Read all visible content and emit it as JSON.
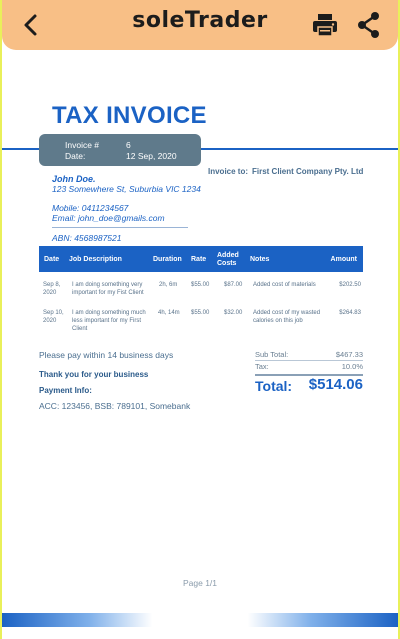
{
  "app": {
    "title": "soleTrader",
    "icons": [
      "back-arrow-icon",
      "printer-icon",
      "share-icon"
    ]
  },
  "invoice": {
    "heading": "TAX INVOICE",
    "meta": {
      "number_label": "Invoice #",
      "number": "6",
      "date_label": "Date:",
      "date": "12 Sep, 2020"
    },
    "from": {
      "name": "John Doe.",
      "address": "123 Somewhere St, Suburbia VIC 1234",
      "mobile": "Mobile: 0411234567",
      "email": "Email: john_doe@gmails.com",
      "abn": "ABN: 4568987521"
    },
    "to_label": "Invoice to:",
    "to_value": "First Client Company Pty. Ltd",
    "table": {
      "headers": {
        "date": "Date",
        "desc": "Job Description",
        "duration": "Duration",
        "rate": "Rate",
        "added_costs": "Added Costs",
        "notes": "Notes",
        "amount": "Amount"
      },
      "rows": [
        {
          "date_l1": "Sep 8,",
          "date_l2": "2020",
          "desc_l1": "I am doing something very",
          "desc_l2": "important for my Fist Client",
          "desc_l3": "",
          "duration": "2h, 6m",
          "rate": "$55.00",
          "added_costs": "$87.00",
          "notes_l1": "Added cost of materials",
          "notes_l2": "",
          "amount": "$202.50"
        },
        {
          "date_l1": "Sep 10,",
          "date_l2": "2020",
          "desc_l1": "I am doing something much",
          "desc_l2": "less important for my First",
          "desc_l3": "Client",
          "duration": "4h, 14m",
          "rate": "$55.00",
          "added_costs": "$32.00",
          "notes_l1": "Added cost of my wasted",
          "notes_l2": "calories on this job",
          "amount": "$264.83"
        }
      ]
    },
    "notes": {
      "pay_within": "Please pay within 14 business days",
      "thanks": "Thank you for your business",
      "payment_info_label": "Payment Info:",
      "payment_info": "ACC: 123456, BSB: 789101, Somebank"
    },
    "totals": {
      "subtotal_label": "Sub Total:",
      "subtotal": "$467.33",
      "tax_label": "Tax:",
      "tax": "10.0%",
      "total_label": "Total:",
      "total": "$514.06"
    },
    "pager": "Page 1/1"
  },
  "colors": {
    "accent": "#1b62c4",
    "appbar": "#f8bf86",
    "frame": "#e9f05a"
  }
}
